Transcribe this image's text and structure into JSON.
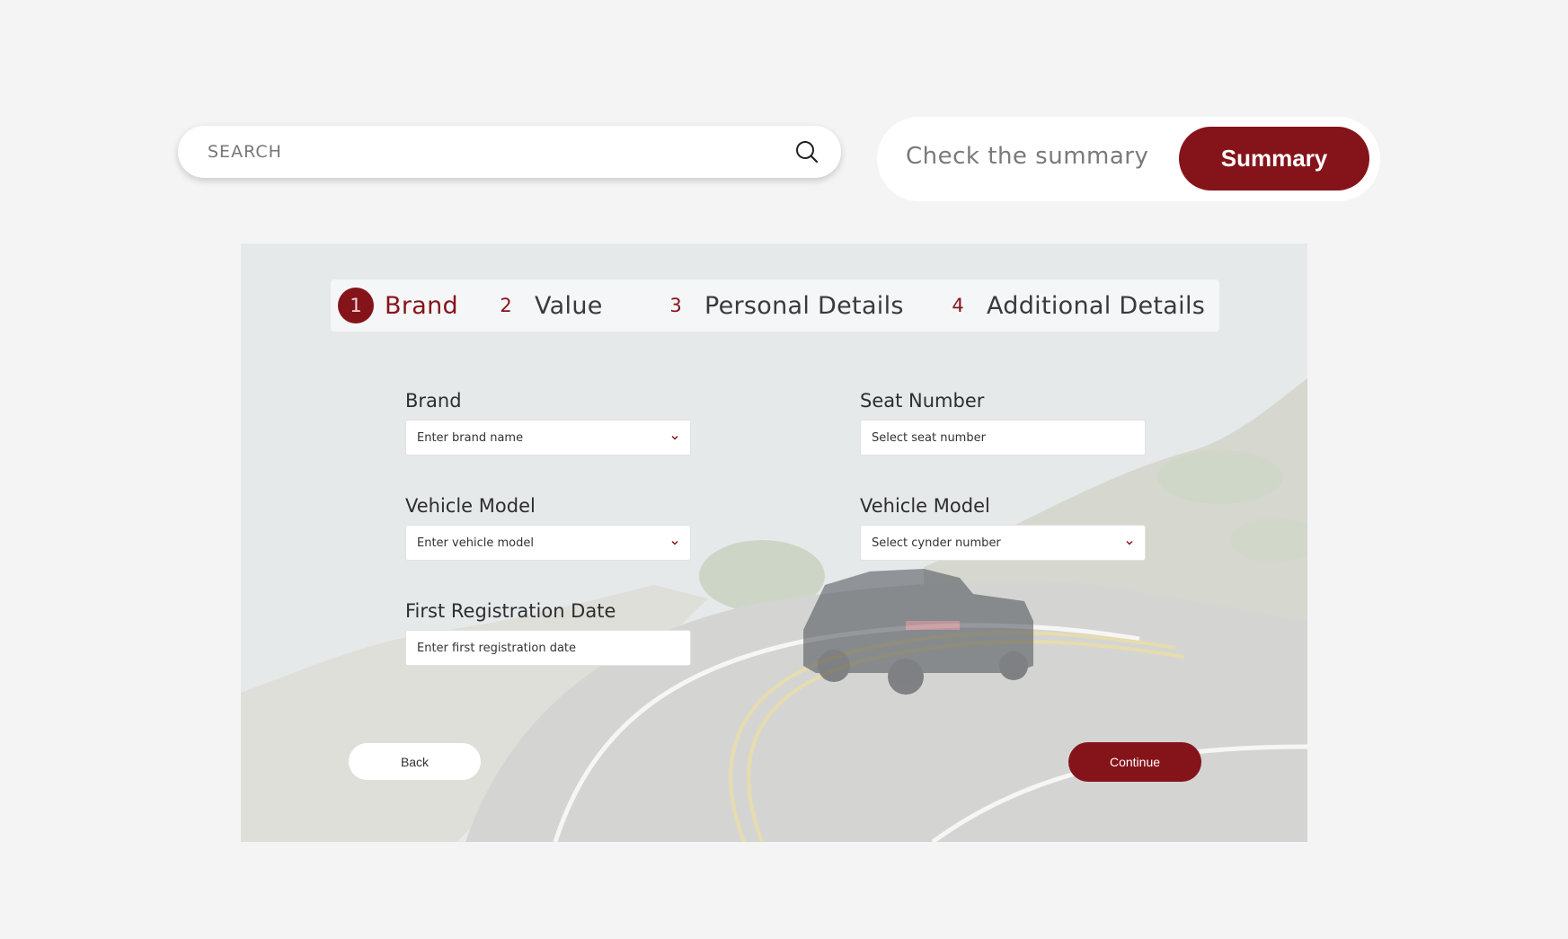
{
  "search": {
    "placeholder": "SEARCH",
    "icon": "search-icon"
  },
  "summary": {
    "prompt": "Check the summary",
    "button_label": "Summary"
  },
  "steps": [
    {
      "number": "1",
      "label": "Brand",
      "active": true
    },
    {
      "number": "2",
      "label": "Value",
      "active": false
    },
    {
      "number": "3",
      "label": "Personal Details",
      "active": false
    },
    {
      "number": "4",
      "label": "Additional Details",
      "active": false
    }
  ],
  "form": {
    "brand": {
      "label": "Brand",
      "placeholder": "Enter brand name",
      "type": "select"
    },
    "vehicle_model": {
      "label": "Vehicle Model",
      "placeholder": "Enter vehicle model",
      "type": "select"
    },
    "first_registration": {
      "label": "First Registration Date",
      "placeholder": "Enter first registration date",
      "type": "text"
    },
    "seat_number": {
      "label": "Seat Number",
      "placeholder": "Select seat number",
      "type": "text"
    },
    "cylinder": {
      "label": "Vehicle Model",
      "placeholder": "Select cynder number",
      "type": "select"
    }
  },
  "actions": {
    "back_label": "Back",
    "continue_label": "Continue"
  },
  "colors": {
    "accent": "#85141a",
    "page_background": "#f4f4f4"
  }
}
